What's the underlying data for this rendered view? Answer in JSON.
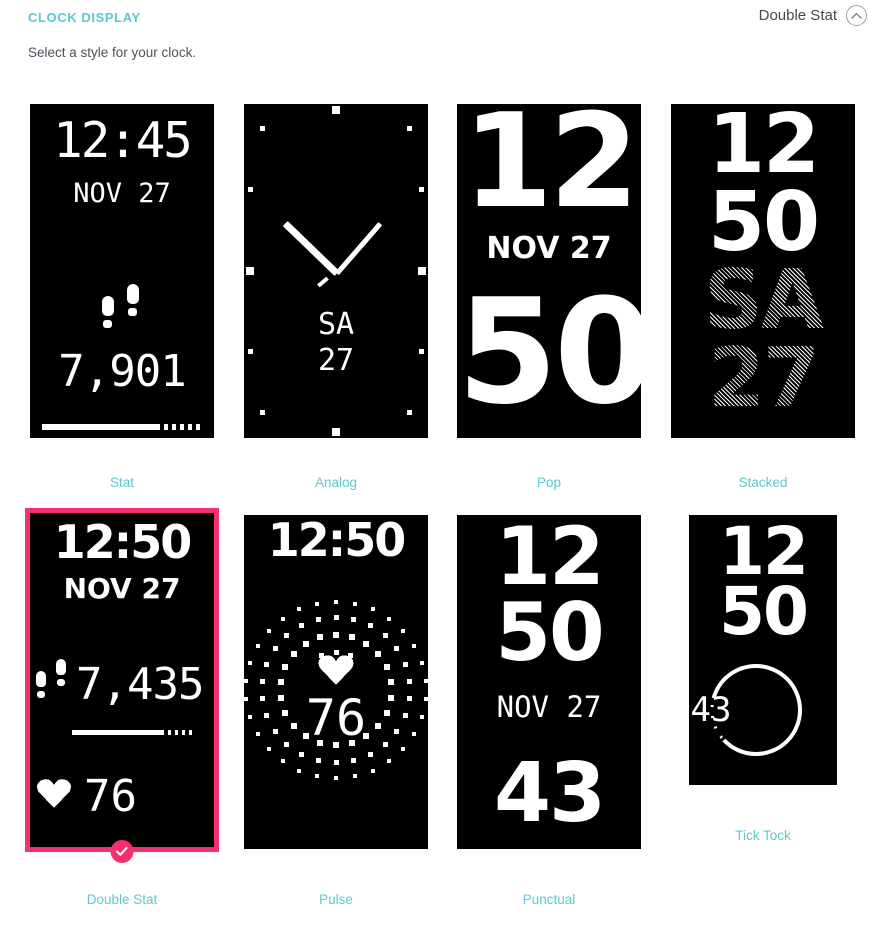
{
  "header": {
    "title": "CLOCK DISPLAY",
    "selected_label": "Double Stat",
    "collapse_icon": "chevron-up-circle-icon"
  },
  "subtitle": "Select a style for your clock.",
  "colors": {
    "accent_teal": "#5BC8D2",
    "selection_pink": "#F4316D",
    "face_background": "#000000",
    "face_foreground": "#FFFFFF",
    "body_text": "#4A5159"
  },
  "clock_faces": [
    {
      "name": "Stat",
      "selected": false,
      "time": "12:45",
      "date": "NOV 27",
      "steps": "7,901",
      "icons": [
        "footprints-icon"
      ],
      "progress_segments": 5
    },
    {
      "name": "Analog",
      "selected": false,
      "day": "SA",
      "date_num": "27",
      "icons": [
        "clock-hands-icon"
      ]
    },
    {
      "name": "Pop",
      "selected": false,
      "hour": "12",
      "minute": "50",
      "date": "NOV 27"
    },
    {
      "name": "Stacked",
      "selected": false,
      "hour": "12",
      "minute": "50",
      "day": "SA",
      "date_num": "27"
    },
    {
      "name": "Double Stat",
      "selected": true,
      "time": "12:50",
      "date": "NOV 27",
      "steps": "7,435",
      "heart_rate": "76",
      "icons": [
        "footprints-icon",
        "heart-icon",
        "check-badge-icon"
      ],
      "progress_segments": 4
    },
    {
      "name": "Pulse",
      "selected": false,
      "time": "12:50",
      "heart_rate": "76",
      "icons": [
        "heart-icon",
        "pulse-rings-icon"
      ]
    },
    {
      "name": "Punctual",
      "selected": false,
      "hour": "12",
      "minute": "50",
      "date": "NOV 27",
      "value": "43"
    },
    {
      "name": "Tick Tock",
      "selected": false,
      "hour": "12",
      "minute": "50",
      "value": "43",
      "icons": [
        "progress-ring-icon"
      ]
    }
  ]
}
